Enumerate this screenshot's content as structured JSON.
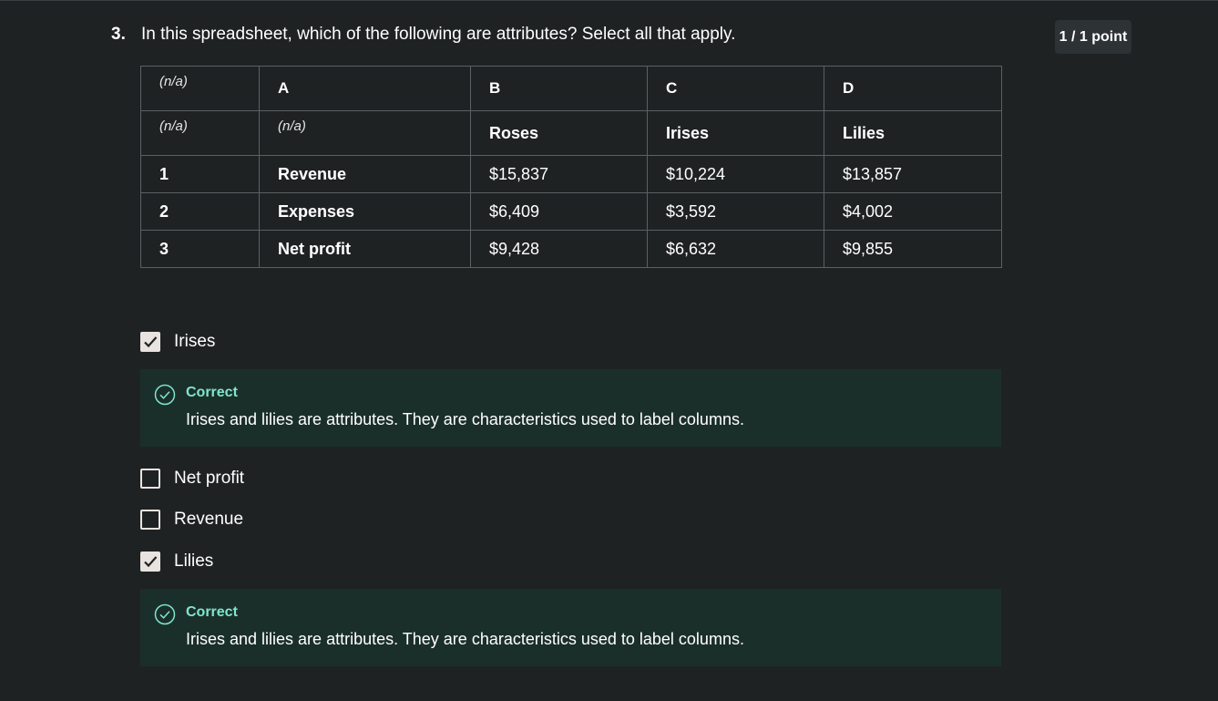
{
  "question": {
    "number": "3.",
    "text": "In this spreadsheet, which of the following are attributes? Select all that apply.",
    "points": "1 / 1 point"
  },
  "table": {
    "rows": [
      [
        "(n/a)",
        "A",
        "B",
        "C",
        "D"
      ],
      [
        "(n/a)",
        "(n/a)",
        "Roses",
        "Irises",
        "Lilies"
      ],
      [
        "1",
        "Revenue",
        "$15,837",
        "$10,224",
        "$13,857"
      ],
      [
        "2",
        "Expenses",
        "$6,409",
        "$3,592",
        "$4,002"
      ],
      [
        "3",
        "Net profit",
        "$9,428",
        "$6,632",
        "$9,855"
      ]
    ]
  },
  "options": [
    {
      "label": "Irises",
      "checked": true
    },
    {
      "label": "Net profit",
      "checked": false
    },
    {
      "label": "Revenue",
      "checked": false
    },
    {
      "label": "Lilies",
      "checked": true
    }
  ],
  "feedback": [
    {
      "title": "Correct",
      "text": "Irises and lilies are attributes. They are characteristics used to label columns."
    },
    {
      "title": "Correct",
      "text": "Irises and lilies are attributes. They are characteristics used to label columns."
    }
  ],
  "icons": {
    "checkmark": "check-icon",
    "correct": "check-circle-icon"
  },
  "colors": {
    "background": "#1f2223",
    "feedback_bg": "#1b2f2a",
    "correct_accent": "#7fe6cd",
    "checkbox": "#e8e3df"
  }
}
